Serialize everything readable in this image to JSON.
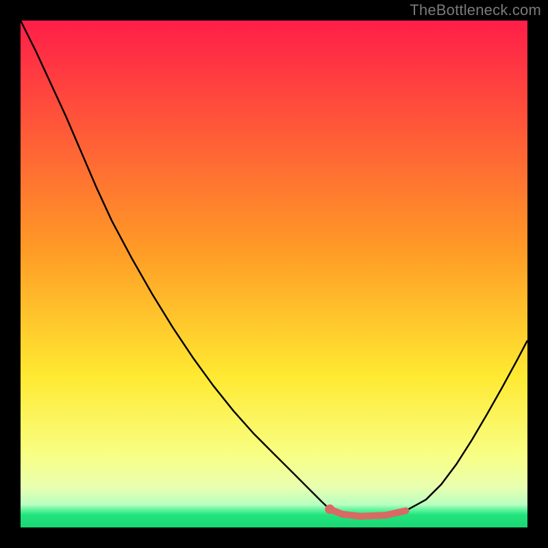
{
  "watermark": "TheBottleneck.com",
  "chart_data": {
    "type": "line",
    "title": "",
    "xlabel": "",
    "ylabel": "",
    "xlim": [
      0,
      100
    ],
    "ylim": [
      0,
      100
    ],
    "gradient_stops": [
      {
        "offset": 0,
        "color": "#ff1e49"
      },
      {
        "offset": 45,
        "color": "#ff9a26"
      },
      {
        "offset": 70,
        "color": "#ffe931"
      },
      {
        "offset": 86,
        "color": "#f8ff86"
      },
      {
        "offset": 92,
        "color": "#e9ffb0"
      },
      {
        "offset": 95.5,
        "color": "#b9ffc0"
      },
      {
        "offset": 96.5,
        "color": "#62f59e"
      },
      {
        "offset": 97.5,
        "color": "#23e37f"
      },
      {
        "offset": 100,
        "color": "#19d873"
      }
    ],
    "series": [
      {
        "name": "bottleneck-curve",
        "color": "#000000",
        "width": 2.5,
        "x": [
          0,
          3,
          6,
          9,
          12,
          15,
          18,
          22,
          26,
          30,
          34,
          38,
          42,
          46,
          50,
          54,
          57,
          59.5,
          61,
          63.5,
          67,
          72,
          76,
          80,
          83,
          86,
          89,
          92,
          95,
          98,
          100
        ],
        "y": [
          100,
          94,
          87.5,
          81,
          74,
          67,
          60.5,
          53,
          46,
          39.5,
          33.5,
          28,
          23,
          18.5,
          14.5,
          10.5,
          7.5,
          5,
          3.6,
          2.6,
          2.2,
          2.4,
          3.3,
          5.5,
          8.5,
          12.5,
          17.2,
          22.3,
          27.6,
          33.1,
          36.9
        ]
      },
      {
        "name": "optimal-range-marker",
        "color": "#d86a63",
        "width": 10,
        "cap": "round",
        "x": [
          61,
          63.5,
          67,
          72,
          76
        ],
        "y": [
          3.6,
          2.6,
          2.2,
          2.4,
          3.3
        ]
      }
    ],
    "marker": {
      "name": "optimal-start-dot",
      "color": "#d86a63",
      "x": 61,
      "y": 3.6,
      "r": 7
    }
  }
}
